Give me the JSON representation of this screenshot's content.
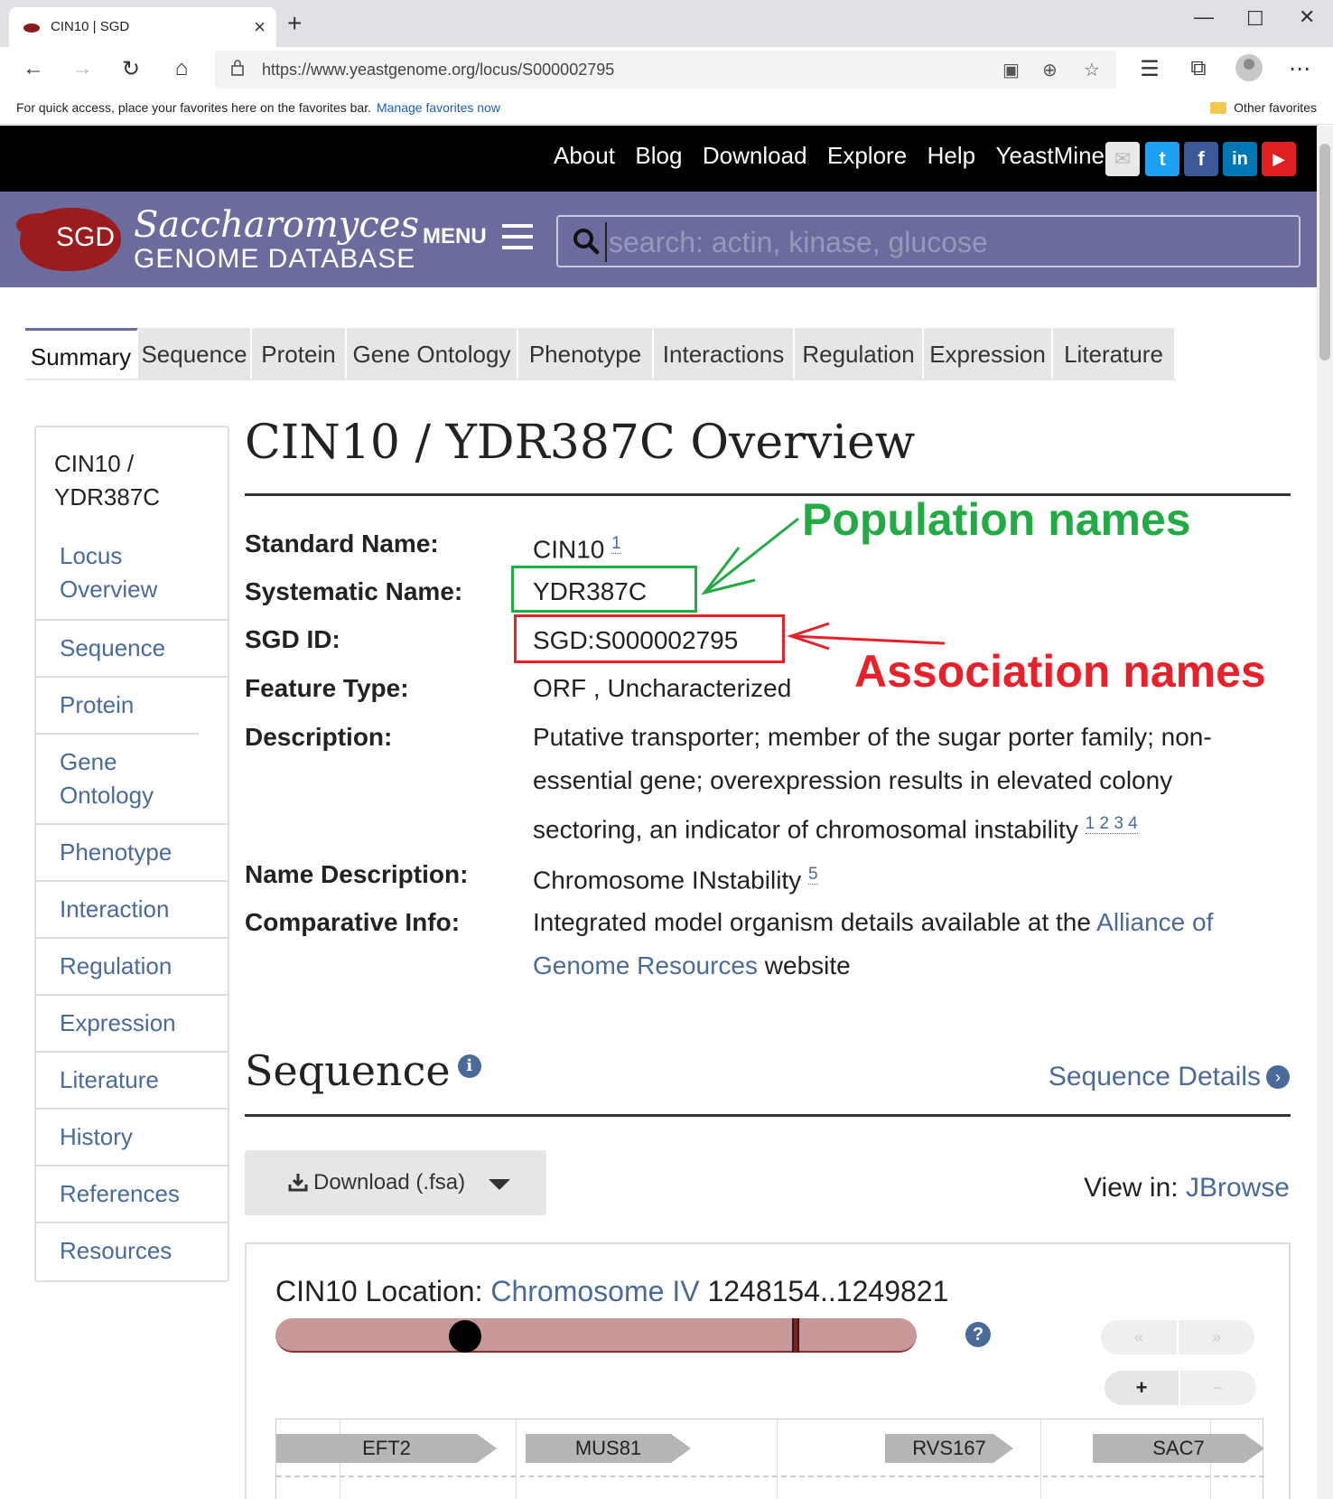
{
  "browser": {
    "tab_title": "CIN10 | SGD",
    "url": "https://www.yeastgenome.org/locus/S000002795",
    "favbar_message": "For quick access, place your favorites here on the favorites bar.",
    "favbar_link": "Manage favorites now",
    "other_favorites": "Other favorites"
  },
  "site": {
    "top_links": [
      "About",
      "Blog",
      "Download",
      "Explore",
      "Help",
      "YeastMine"
    ],
    "logo_abbr": "SGD",
    "logo_title": "Saccharomyces",
    "logo_subtitle": "GENOME DATABASE",
    "menu_label": "MENU",
    "search_placeholder": "search: actin, kinase, glucose"
  },
  "tabs": [
    "Summary",
    "Sequence",
    "Protein",
    "Gene Ontology",
    "Phenotype",
    "Interactions",
    "Regulation",
    "Expression",
    "Literature"
  ],
  "sidenav": {
    "header": "CIN10 / YDR387C",
    "items": [
      "Locus Overview",
      "Sequence",
      "Protein",
      "Gene Ontology",
      "Phenotype",
      "Interaction",
      "Regulation",
      "Expression",
      "Literature",
      "History",
      "References",
      "Resources"
    ]
  },
  "overview": {
    "title": "CIN10 / YDR387C Overview",
    "labels": {
      "standard_name": "Standard Name:",
      "systematic_name": "Systematic Name:",
      "sgd_id": "SGD ID:",
      "feature_type": "Feature Type:",
      "description": "Description:",
      "name_description": "Name Description:",
      "comparative_info": "Comparative Info:"
    },
    "standard_name": "CIN10",
    "standard_name_ref": "1",
    "systematic_name": "YDR387C",
    "sgd_id": "SGD:S000002795",
    "feature_type": "ORF , Uncharacterized",
    "description": "Putative transporter; member of the sugar porter family; non-essential gene; overexpression results in elevated colony sectoring, an indicator of chromosomal instability",
    "description_refs": "1 2 3 4",
    "name_description": "Chromosome INstability",
    "name_description_ref": "5",
    "comparative_pre": "Integrated model organism details available at the",
    "comparative_link": "Alliance of Genome Resources",
    "comparative_post": "website"
  },
  "annotations": {
    "population": "Population names",
    "association": "Association names",
    "population_color": "#22aa44",
    "association_color": "#e8202a"
  },
  "sequence": {
    "title": "Sequence",
    "details_link": "Sequence Details",
    "download_label": "Download (.fsa)",
    "view_in_label": "View in:",
    "view_in_link": "JBrowse",
    "location_label": "CIN10 Location:",
    "chromosome_link": "Chromosome IV",
    "coordinates": "1248154..1249821",
    "zoom_buttons": [
      "«",
      "»",
      "+",
      "−"
    ],
    "genes": [
      "EFT2",
      "MUS81",
      "RVS167",
      "SAC7"
    ]
  },
  "colors": {
    "header_purple": "#6b6b9e",
    "link_blue": "#4a6a9a",
    "chromosome": "#c89898"
  }
}
